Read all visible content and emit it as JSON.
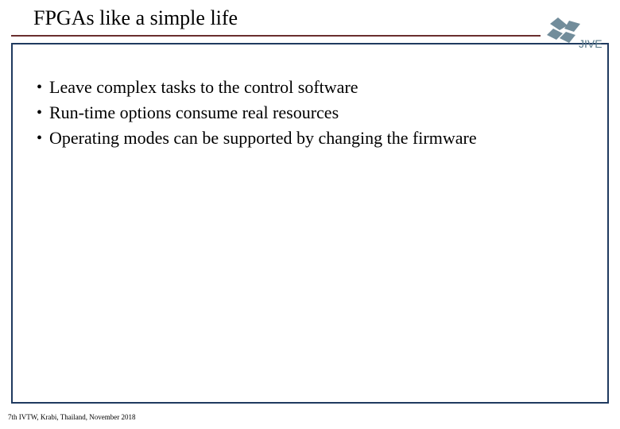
{
  "title": "FPGAs like a simple life",
  "bullets": [
    "Leave complex tasks to the control software",
    "Run-time options consume real resources",
    "Operating modes can be supported by changing the firmware"
  ],
  "footer": {
    "sup": "7th",
    "rest": " IVTW, Krabi, Thailand, November 2018"
  },
  "logo": {
    "text": "JIVE",
    "color": "#5a7a8a"
  }
}
